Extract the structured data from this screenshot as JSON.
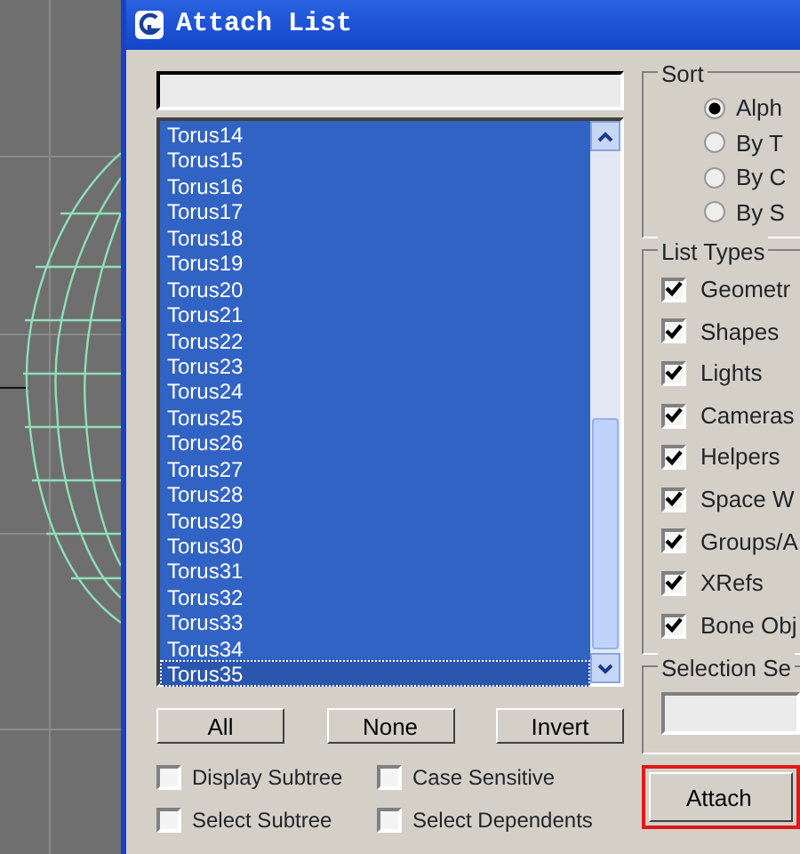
{
  "window": {
    "title": "Attach List"
  },
  "objects": [
    {
      "label": "Torus14",
      "selected": true,
      "focused": false
    },
    {
      "label": "Torus15",
      "selected": true,
      "focused": false
    },
    {
      "label": "Torus16",
      "selected": true,
      "focused": false
    },
    {
      "label": "Torus17",
      "selected": true,
      "focused": false
    },
    {
      "label": "Torus18",
      "selected": true,
      "focused": false
    },
    {
      "label": "Torus19",
      "selected": true,
      "focused": false
    },
    {
      "label": "Torus20",
      "selected": true,
      "focused": false
    },
    {
      "label": "Torus21",
      "selected": true,
      "focused": false
    },
    {
      "label": "Torus22",
      "selected": true,
      "focused": false
    },
    {
      "label": "Torus23",
      "selected": true,
      "focused": false
    },
    {
      "label": "Torus24",
      "selected": true,
      "focused": false
    },
    {
      "label": "Torus25",
      "selected": true,
      "focused": false
    },
    {
      "label": "Torus26",
      "selected": true,
      "focused": false
    },
    {
      "label": "Torus27",
      "selected": true,
      "focused": false
    },
    {
      "label": "Torus28",
      "selected": true,
      "focused": false
    },
    {
      "label": "Torus29",
      "selected": true,
      "focused": false
    },
    {
      "label": "Torus30",
      "selected": true,
      "focused": false
    },
    {
      "label": "Torus31",
      "selected": true,
      "focused": false
    },
    {
      "label": "Torus32",
      "selected": true,
      "focused": false
    },
    {
      "label": "Torus33",
      "selected": true,
      "focused": false
    },
    {
      "label": "Torus34",
      "selected": true,
      "focused": false
    },
    {
      "label": "Torus35",
      "selected": true,
      "focused": true
    }
  ],
  "list_buttons": [
    "All",
    "None",
    "Invert"
  ],
  "options": [
    {
      "label": "Display Subtree",
      "checked": false
    },
    {
      "label": "Case Sensitive",
      "checked": false
    },
    {
      "label": "Select Subtree",
      "checked": false
    },
    {
      "label": "Select Dependents",
      "checked": false
    }
  ],
  "sort": {
    "title": "Sort",
    "options": [
      {
        "label": "Alph",
        "selected": true
      },
      {
        "label": "By T",
        "selected": false
      },
      {
        "label": "By C",
        "selected": false
      },
      {
        "label": "By S",
        "selected": false
      }
    ]
  },
  "list_types": {
    "title": "List Types",
    "options": [
      {
        "label": "Geometr",
        "checked": true
      },
      {
        "label": "Shapes",
        "checked": true
      },
      {
        "label": "Lights",
        "checked": true
      },
      {
        "label": "Cameras",
        "checked": true
      },
      {
        "label": "Helpers",
        "checked": true
      },
      {
        "label": "Space W",
        "checked": true
      },
      {
        "label": "Groups/A",
        "checked": true
      },
      {
        "label": "XRefs",
        "checked": true
      },
      {
        "label": "Bone Obj",
        "checked": true
      }
    ]
  },
  "selection_sets": {
    "title": "Selection Se"
  },
  "attach_button": {
    "label": "Attach",
    "highlighted": true
  }
}
